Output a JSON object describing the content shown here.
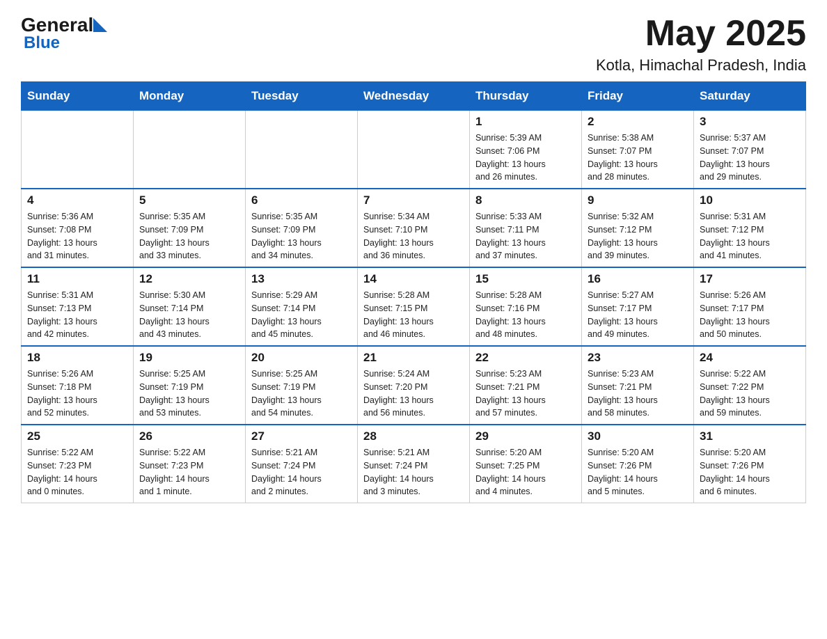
{
  "header": {
    "logo_general": "General",
    "logo_blue": "Blue",
    "month_year": "May 2025",
    "location": "Kotla, Himachal Pradesh, India"
  },
  "days_of_week": [
    "Sunday",
    "Monday",
    "Tuesday",
    "Wednesday",
    "Thursday",
    "Friday",
    "Saturday"
  ],
  "weeks": [
    [
      {
        "day": "",
        "info": ""
      },
      {
        "day": "",
        "info": ""
      },
      {
        "day": "",
        "info": ""
      },
      {
        "day": "",
        "info": ""
      },
      {
        "day": "1",
        "info": "Sunrise: 5:39 AM\nSunset: 7:06 PM\nDaylight: 13 hours\nand 26 minutes."
      },
      {
        "day": "2",
        "info": "Sunrise: 5:38 AM\nSunset: 7:07 PM\nDaylight: 13 hours\nand 28 minutes."
      },
      {
        "day": "3",
        "info": "Sunrise: 5:37 AM\nSunset: 7:07 PM\nDaylight: 13 hours\nand 29 minutes."
      }
    ],
    [
      {
        "day": "4",
        "info": "Sunrise: 5:36 AM\nSunset: 7:08 PM\nDaylight: 13 hours\nand 31 minutes."
      },
      {
        "day": "5",
        "info": "Sunrise: 5:35 AM\nSunset: 7:09 PM\nDaylight: 13 hours\nand 33 minutes."
      },
      {
        "day": "6",
        "info": "Sunrise: 5:35 AM\nSunset: 7:09 PM\nDaylight: 13 hours\nand 34 minutes."
      },
      {
        "day": "7",
        "info": "Sunrise: 5:34 AM\nSunset: 7:10 PM\nDaylight: 13 hours\nand 36 minutes."
      },
      {
        "day": "8",
        "info": "Sunrise: 5:33 AM\nSunset: 7:11 PM\nDaylight: 13 hours\nand 37 minutes."
      },
      {
        "day": "9",
        "info": "Sunrise: 5:32 AM\nSunset: 7:12 PM\nDaylight: 13 hours\nand 39 minutes."
      },
      {
        "day": "10",
        "info": "Sunrise: 5:31 AM\nSunset: 7:12 PM\nDaylight: 13 hours\nand 41 minutes."
      }
    ],
    [
      {
        "day": "11",
        "info": "Sunrise: 5:31 AM\nSunset: 7:13 PM\nDaylight: 13 hours\nand 42 minutes."
      },
      {
        "day": "12",
        "info": "Sunrise: 5:30 AM\nSunset: 7:14 PM\nDaylight: 13 hours\nand 43 minutes."
      },
      {
        "day": "13",
        "info": "Sunrise: 5:29 AM\nSunset: 7:14 PM\nDaylight: 13 hours\nand 45 minutes."
      },
      {
        "day": "14",
        "info": "Sunrise: 5:28 AM\nSunset: 7:15 PM\nDaylight: 13 hours\nand 46 minutes."
      },
      {
        "day": "15",
        "info": "Sunrise: 5:28 AM\nSunset: 7:16 PM\nDaylight: 13 hours\nand 48 minutes."
      },
      {
        "day": "16",
        "info": "Sunrise: 5:27 AM\nSunset: 7:17 PM\nDaylight: 13 hours\nand 49 minutes."
      },
      {
        "day": "17",
        "info": "Sunrise: 5:26 AM\nSunset: 7:17 PM\nDaylight: 13 hours\nand 50 minutes."
      }
    ],
    [
      {
        "day": "18",
        "info": "Sunrise: 5:26 AM\nSunset: 7:18 PM\nDaylight: 13 hours\nand 52 minutes."
      },
      {
        "day": "19",
        "info": "Sunrise: 5:25 AM\nSunset: 7:19 PM\nDaylight: 13 hours\nand 53 minutes."
      },
      {
        "day": "20",
        "info": "Sunrise: 5:25 AM\nSunset: 7:19 PM\nDaylight: 13 hours\nand 54 minutes."
      },
      {
        "day": "21",
        "info": "Sunrise: 5:24 AM\nSunset: 7:20 PM\nDaylight: 13 hours\nand 56 minutes."
      },
      {
        "day": "22",
        "info": "Sunrise: 5:23 AM\nSunset: 7:21 PM\nDaylight: 13 hours\nand 57 minutes."
      },
      {
        "day": "23",
        "info": "Sunrise: 5:23 AM\nSunset: 7:21 PM\nDaylight: 13 hours\nand 58 minutes."
      },
      {
        "day": "24",
        "info": "Sunrise: 5:22 AM\nSunset: 7:22 PM\nDaylight: 13 hours\nand 59 minutes."
      }
    ],
    [
      {
        "day": "25",
        "info": "Sunrise: 5:22 AM\nSunset: 7:23 PM\nDaylight: 14 hours\nand 0 minutes."
      },
      {
        "day": "26",
        "info": "Sunrise: 5:22 AM\nSunset: 7:23 PM\nDaylight: 14 hours\nand 1 minute."
      },
      {
        "day": "27",
        "info": "Sunrise: 5:21 AM\nSunset: 7:24 PM\nDaylight: 14 hours\nand 2 minutes."
      },
      {
        "day": "28",
        "info": "Sunrise: 5:21 AM\nSunset: 7:24 PM\nDaylight: 14 hours\nand 3 minutes."
      },
      {
        "day": "29",
        "info": "Sunrise: 5:20 AM\nSunset: 7:25 PM\nDaylight: 14 hours\nand 4 minutes."
      },
      {
        "day": "30",
        "info": "Sunrise: 5:20 AM\nSunset: 7:26 PM\nDaylight: 14 hours\nand 5 minutes."
      },
      {
        "day": "31",
        "info": "Sunrise: 5:20 AM\nSunset: 7:26 PM\nDaylight: 14 hours\nand 6 minutes."
      }
    ]
  ]
}
